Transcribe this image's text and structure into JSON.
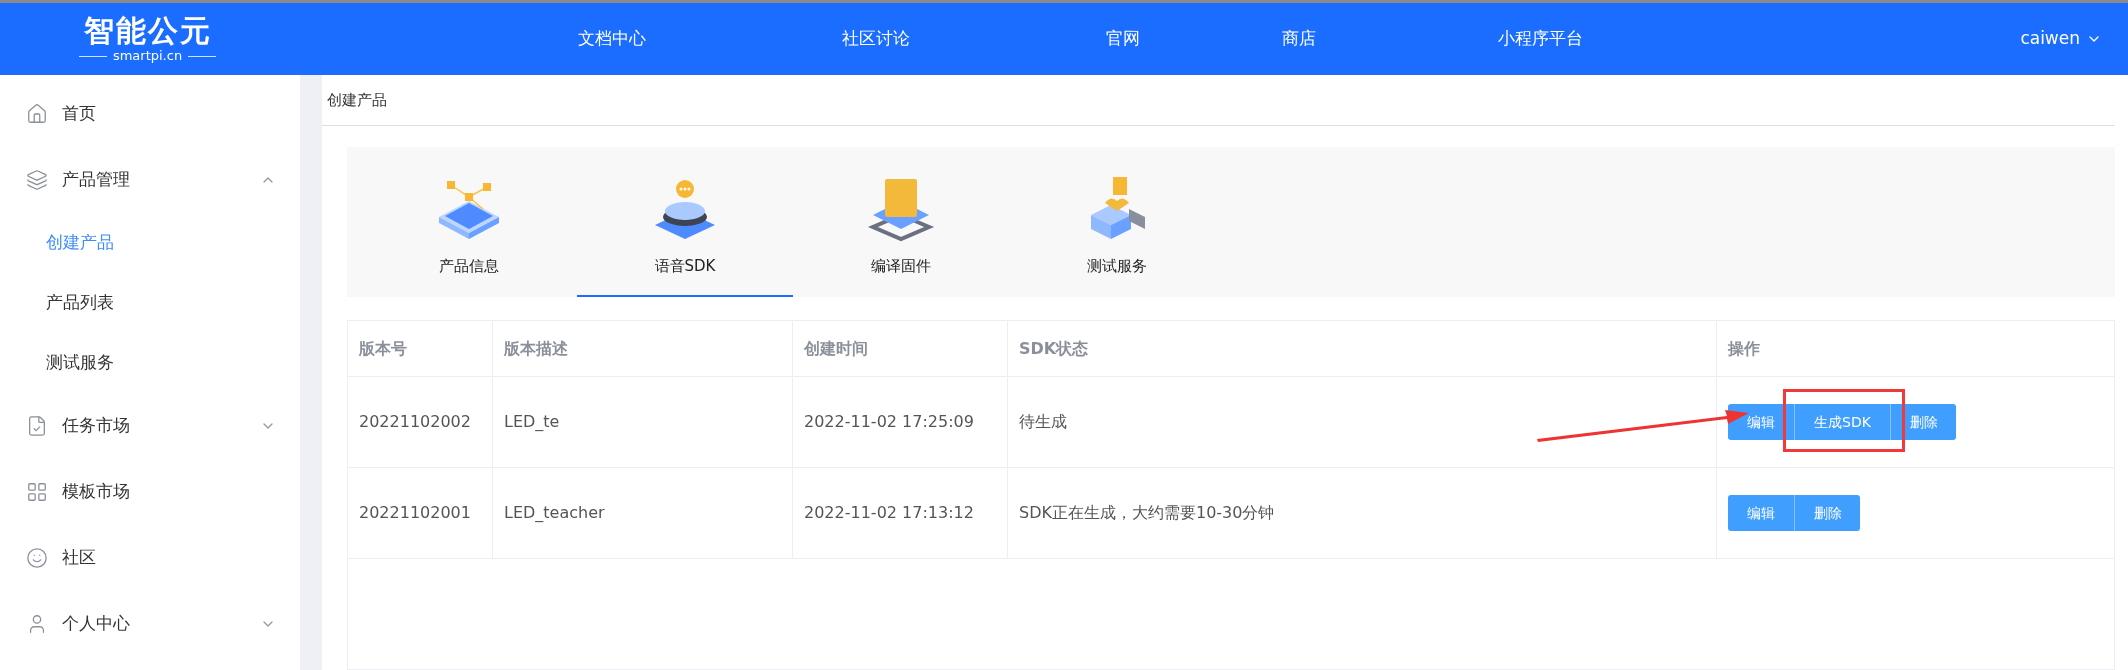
{
  "header": {
    "logo": {
      "name": "智能公元",
      "domain": "smartpi.cn"
    },
    "nav": [
      "文档中心",
      "社区讨论",
      "官网",
      "商店",
      "小程序平台"
    ],
    "user": "caiwen"
  },
  "sidebar": {
    "items": [
      {
        "label": "首页",
        "selected": false
      },
      {
        "label": "产品管理",
        "selected": false,
        "expanded": true,
        "children": [
          {
            "label": "创建产品",
            "selected": true
          },
          {
            "label": "产品列表",
            "selected": false
          },
          {
            "label": "测试服务",
            "selected": false
          }
        ]
      },
      {
        "label": "任务市场",
        "selected": false,
        "expanded": false
      },
      {
        "label": "模板市场",
        "selected": false
      },
      {
        "label": "社区",
        "selected": false
      },
      {
        "label": "个人中心",
        "selected": false,
        "expanded": false
      }
    ]
  },
  "breadcrumb": "创建产品",
  "steps": [
    {
      "label": "产品信息",
      "selected": false
    },
    {
      "label": "语音SDK",
      "selected": true
    },
    {
      "label": "编译固件",
      "selected": false
    },
    {
      "label": "测试服务",
      "selected": false
    }
  ],
  "table": {
    "columns": [
      "版本号",
      "版本描述",
      "创建时间",
      "SDK状态",
      "操作"
    ],
    "rows": [
      {
        "cells": [
          "20221102002",
          "LED_te",
          "2022-11-02 17:25:09",
          "待生成"
        ],
        "actions": [
          "编辑",
          "生成SDK",
          "删除"
        ]
      },
      {
        "cells": [
          "20221102001",
          "LED_teacher",
          "2022-11-02 17:13:12",
          "SDK正在生成，大约需要10-30分钟"
        ],
        "actions": [
          "编辑",
          "删除"
        ]
      }
    ]
  }
}
